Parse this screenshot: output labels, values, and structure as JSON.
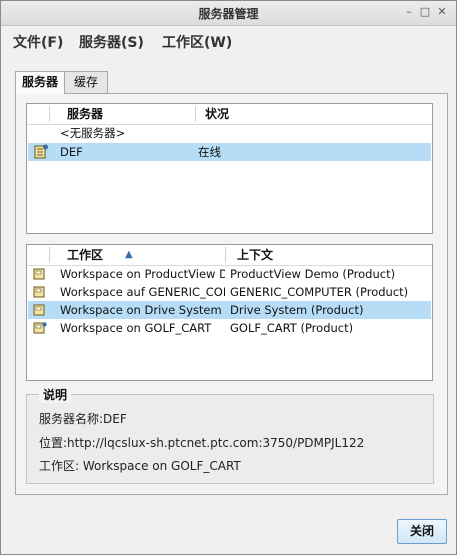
{
  "window": {
    "title": "服务器管理"
  },
  "menu": {
    "file": "文件(F)",
    "server": "服务器(S)",
    "workspace": "工作区(W)"
  },
  "tabs": [
    {
      "label": "服务器"
    },
    {
      "label": "缓存"
    }
  ],
  "servers": {
    "columns": {
      "server": "服务器",
      "status": "状况"
    },
    "rows": [
      {
        "name": "<无服务器>",
        "status": ""
      },
      {
        "name": "DEF",
        "status": "在线"
      }
    ]
  },
  "workspaces": {
    "columns": {
      "workspace": "工作区",
      "context": "上下文"
    },
    "sort_indicator": "▲",
    "rows": [
      {
        "name": "Workspace on ProductView Demo",
        "context": "ProductView Demo (Product)"
      },
      {
        "name": "Workspace auf GENERIC_COM...",
        "context": "GENERIC_COMPUTER (Product)"
      },
      {
        "name": "Workspace on Drive System",
        "context": "Drive System (Product)"
      },
      {
        "name": "Workspace on GOLF_CART",
        "context": "GOLF_CART (Product)"
      }
    ]
  },
  "description": {
    "title": "说明",
    "server_name": "服务器名称:DEF",
    "location": "位置:http://lqcslux-sh.ptcnet.ptc.com:3750/PDMPJL122",
    "workspace": "工作区: Workspace on GOLF_CART"
  },
  "buttons": {
    "close": "关闭"
  },
  "colors": {
    "selection": "#b6ddf5",
    "sort_arrow": "#3a6ea5"
  }
}
